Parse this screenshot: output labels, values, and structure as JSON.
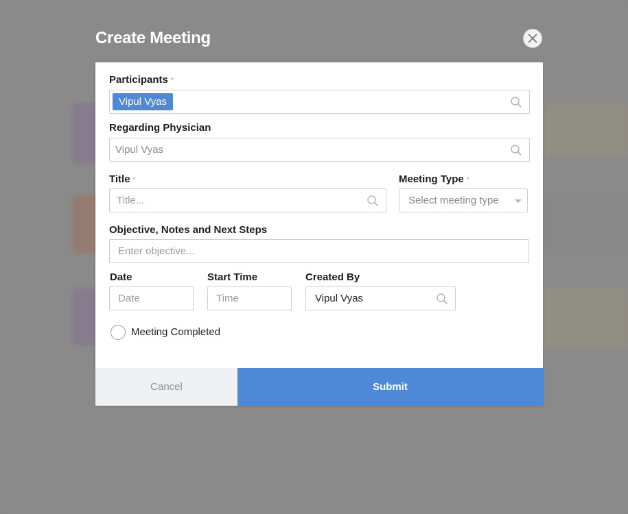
{
  "modal": {
    "title": "Create Meeting",
    "close_icon": "close-icon"
  },
  "form": {
    "participants": {
      "label": "Participants",
      "required_mark": "*",
      "chips": [
        "Vipul Vyas"
      ]
    },
    "regarding_physician": {
      "label": "Regarding Physician",
      "value": "Vipul Vyas"
    },
    "title": {
      "label": "Title",
      "required_mark": "*",
      "placeholder": "Title..."
    },
    "meeting_type": {
      "label": "Meeting Type",
      "required_mark": "*",
      "placeholder": "Select meeting type"
    },
    "objective": {
      "label": "Objective, Notes and Next Steps",
      "placeholder": "Enter objective..."
    },
    "date": {
      "label": "Date",
      "placeholder": "Date"
    },
    "start_time": {
      "label": "Start Time",
      "placeholder": "Time"
    },
    "created_by": {
      "label": "Created By",
      "value": "Vipul Vyas"
    },
    "meeting_completed": {
      "label": "Meeting Completed",
      "checked": false
    }
  },
  "actions": {
    "cancel_label": "Cancel",
    "submit_label": "Submit"
  },
  "colors": {
    "accent": "#4f88d6",
    "cancel_bg": "#eef0f4",
    "overlay": "#8e8e8e"
  }
}
